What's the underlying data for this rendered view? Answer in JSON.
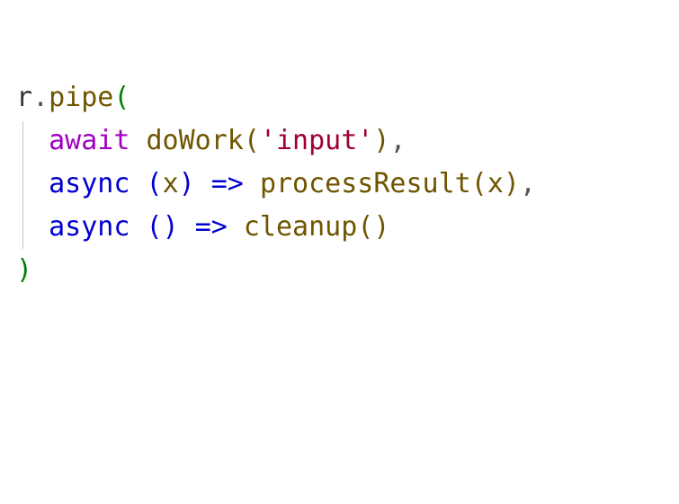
{
  "code": {
    "obj": "r",
    "dot": ".",
    "method": "pipe",
    "openParen": "(",
    "closeParen": ")",
    "comma": ",",
    "arrow": "=>",
    "awaitKw": "await",
    "asyncKw": "async",
    "call1_fn": "doWork",
    "call1_argString": "'input'",
    "lambda2_param": "x",
    "lambda2_body_fn": "processResult",
    "lambda2_body_arg": "x",
    "lambda3_params": "",
    "lambda3_body_fn": "cleanup",
    "innerOpen": "(",
    "innerClose": ")",
    "space": " ",
    "indent": "  "
  }
}
